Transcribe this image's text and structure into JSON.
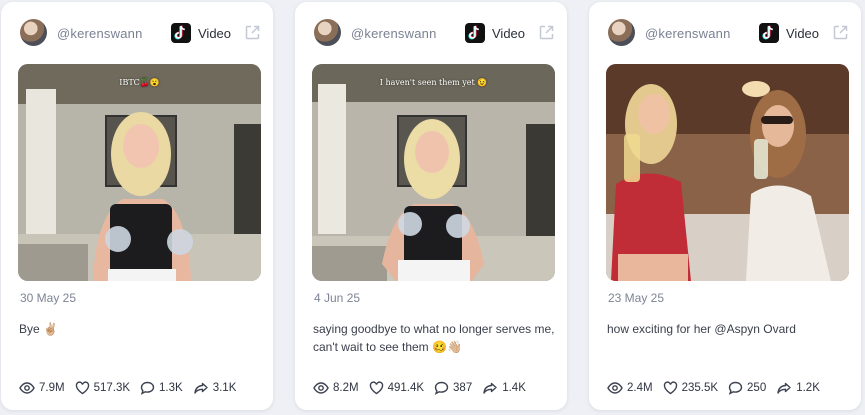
{
  "cards": [
    {
      "username": "@kerenswann",
      "platform": "tiktok-icon",
      "type_label": "Video",
      "overlay_caption": "IBTC🍒😮",
      "date": "30 May 25",
      "caption": "Bye ✌🏼",
      "stats": {
        "views": "7.9M",
        "likes": "517.3K",
        "comments": "1.3K",
        "shares": "3.1K"
      }
    },
    {
      "username": "@kerenswann",
      "platform": "tiktok-icon",
      "type_label": "Video",
      "overlay_caption": "I haven't seen them yet 😉",
      "date": "4 Jun 25",
      "caption": "saying goodbye to what no longer serves me, can't wait to see them 🥴👋🏼",
      "stats": {
        "views": "8.2M",
        "likes": "491.4K",
        "comments": "387",
        "shares": "1.4K"
      }
    },
    {
      "username": "@kerenswann",
      "platform": "tiktok-icon",
      "type_label": "Video",
      "overlay_caption": "",
      "date": "23 May 25",
      "caption": "how exciting for her @Aspyn Ovard",
      "stats": {
        "views": "2.4M",
        "likes": "235.5K",
        "comments": "250",
        "shares": "1.2K"
      }
    }
  ],
  "colors": {
    "card_bg": "#ffffff",
    "page_bg": "#eef0f5",
    "muted_text": "#7a8191",
    "body_text": "#3a3f4b"
  }
}
